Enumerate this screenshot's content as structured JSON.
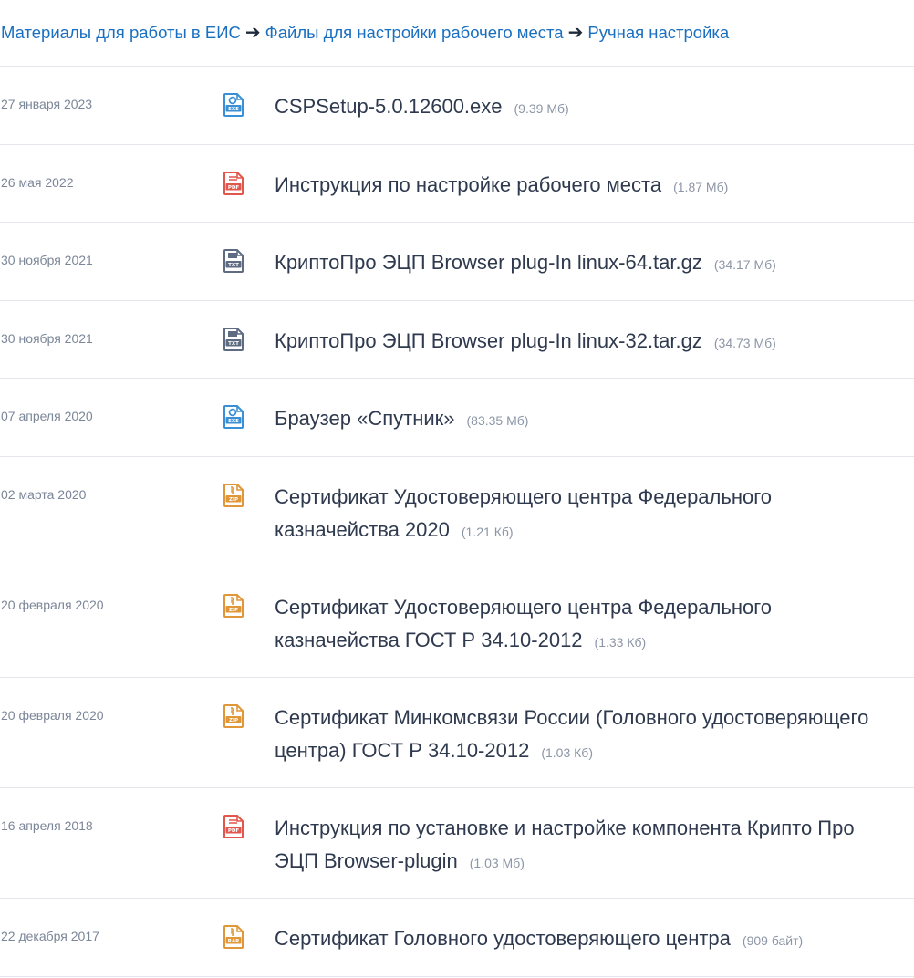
{
  "breadcrumb": {
    "items": [
      "Материалы для работы в ЕИС",
      "Файлы для настройки рабочего места",
      "Ручная настройка"
    ],
    "separator": "➔"
  },
  "files": [
    {
      "date": "27 января 2023",
      "title": "CSPSetup-5.0.12600.exe",
      "size": "(9.39 Мб)",
      "icon": "exe-file-icon",
      "icon_label": "EXE",
      "color": "#3a8fd6"
    },
    {
      "date": "26 мая 2022",
      "title": "Инструкция по настройке рабочего места",
      "size": "(1.87 Мб)",
      "icon": "pdf-file-icon",
      "icon_label": "PDF",
      "color": "#e2574c"
    },
    {
      "date": "30 ноября 2021",
      "title": "КриптоПро ЭЦП Browser plug-In linux-64.tar.gz",
      "size": "(34.17 Мб)",
      "icon": "txt-file-icon",
      "icon_label": "TXT",
      "color": "#5f6b80"
    },
    {
      "date": "30 ноября 2021",
      "title": "КриптоПро ЭЦП Browser plug-In linux-32.tar.gz",
      "size": "(34.73 Мб)",
      "icon": "txt-file-icon",
      "icon_label": "TXT",
      "color": "#5f6b80"
    },
    {
      "date": "07 апреля 2020",
      "title": "Браузер «Спутник»",
      "size": "(83.35 Мб)",
      "icon": "exe-file-icon",
      "icon_label": "EXE",
      "color": "#3a8fd6"
    },
    {
      "date": "02 марта 2020",
      "title": "Сертификат Удостоверяющего центра Федерального казначейства 2020",
      "size": "(1.21 Кб)",
      "icon": "zip-file-icon",
      "icon_label": "ZIP",
      "color": "#e0973a"
    },
    {
      "date": "20 февраля 2020",
      "title": "Сертификат Удостоверяющего центра Федерального казначейства ГОСТ Р 34.10-2012",
      "size": "(1.33 Кб)",
      "icon": "zip-file-icon",
      "icon_label": "ZIP",
      "color": "#e0973a"
    },
    {
      "date": "20 февраля 2020",
      "title": "Сертификат Минкомсвязи России (Головного удостоверяющего центра) ГОСТ Р 34.10-2012",
      "size": "(1.03 Кб)",
      "icon": "zip-file-icon",
      "icon_label": "ZIP",
      "color": "#e0973a"
    },
    {
      "date": "16 апреля 2018",
      "title": "Инструкция по установке и настройке компонента Крипто Про ЭЦП Browser-plugin",
      "size": "(1.03 Мб)",
      "icon": "pdf-file-icon",
      "icon_label": "PDF",
      "color": "#e2574c"
    },
    {
      "date": "22 декабря 2017",
      "title": "Сертификат Головного удостоверяющего центра",
      "size": "(909 байт)",
      "icon": "rar-file-icon",
      "icon_label": "RAR",
      "color": "#e0973a"
    }
  ]
}
